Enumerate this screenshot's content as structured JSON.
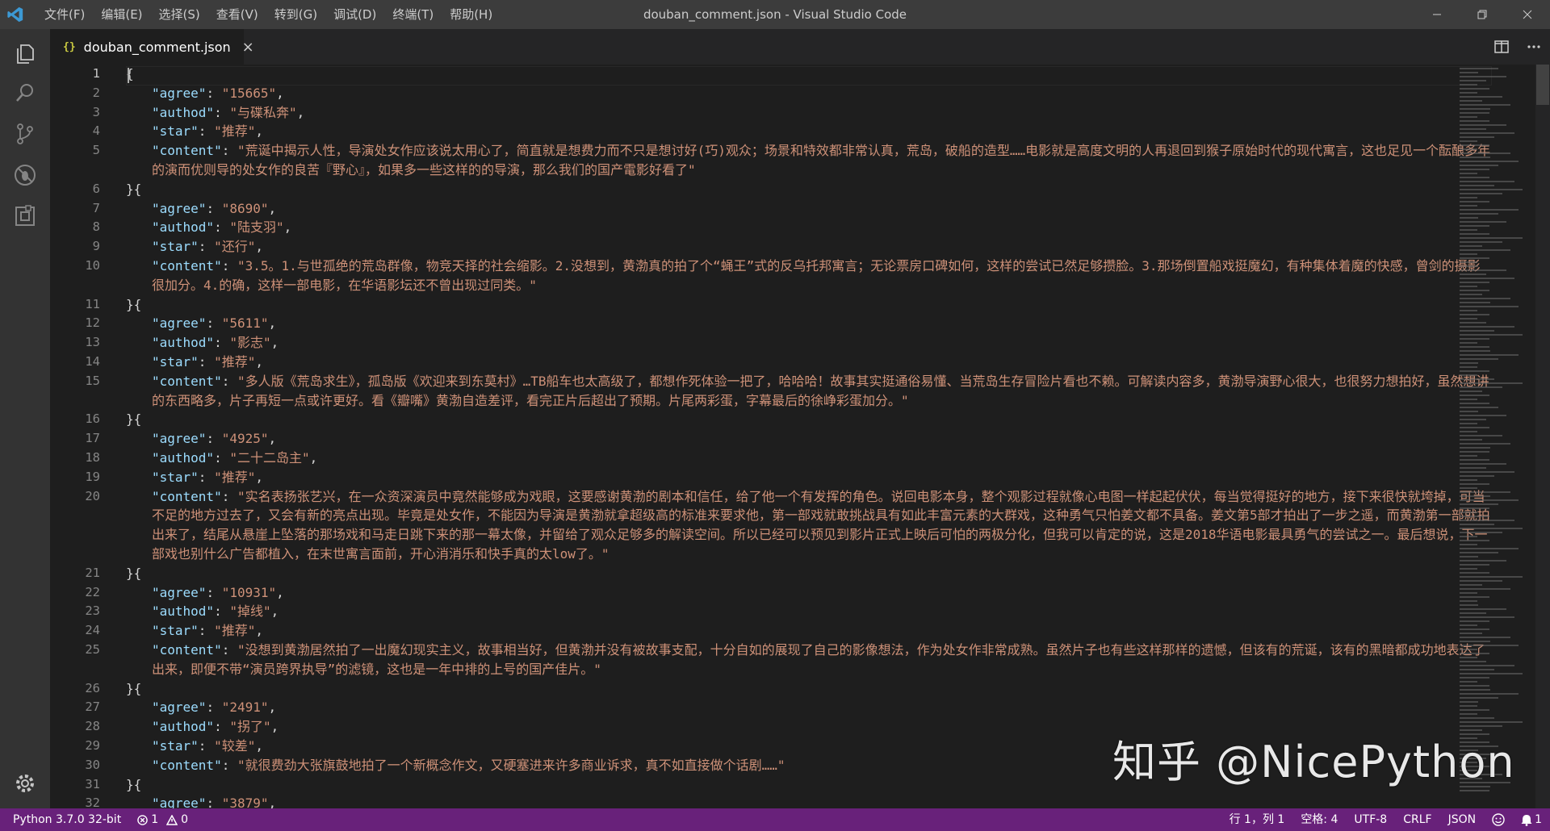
{
  "titlebar": {
    "menu": [
      "文件(F)",
      "编辑(E)",
      "选择(S)",
      "查看(V)",
      "转到(G)",
      "调试(D)",
      "终端(T)",
      "帮助(H)"
    ],
    "title": "douban_comment.json - Visual Studio Code"
  },
  "activitybar": {
    "items": [
      "explorer-icon",
      "search-icon",
      "source-control-icon",
      "debug-icon",
      "extensions-icon"
    ],
    "bottom": "gear-icon"
  },
  "tab": {
    "icon_text": "{}",
    "label": "douban_comment.json",
    "close": "×"
  },
  "editor": {
    "line_numbers": [
      "1",
      "2",
      "3",
      "4",
      "5",
      "6",
      "7",
      "8",
      "9",
      "10",
      "11",
      "12",
      "13",
      "14",
      "15",
      "16",
      "17",
      "18",
      "19",
      "20",
      "21",
      "22",
      "23",
      "24",
      "25",
      "26",
      "27",
      "28",
      "29",
      "30",
      "31",
      "32"
    ],
    "open_brace": "{",
    "separator": "}{",
    "close_brace": "}",
    "records": [
      {
        "agree": "15665",
        "authod": "与碟私奔",
        "star": "推荐",
        "content": "荒诞中揭示人性，导演处女作应该说太用心了，简直就是想费力而不只是想讨好(巧)观众；场景和特效都非常认真，荒岛，破船的造型……电影就是高度文明的人再退回到猴子原始时代的现代寓言，这也足见一个酝酿多年的演而优则导的处女作的良苦『野心』，如果多一些这样的的导演，那么我们的国产電影好看了"
      },
      {
        "agree": "8690",
        "authod": "陆支羽",
        "star": "还行",
        "content": "3.5。1.与世孤绝的荒岛群像，物竞天择的社会缩影。2.没想到，黄渤真的拍了个“蝇王”式的反乌托邦寓言；无论票房口碑如何，这样的尝试已然足够攒脸。3.那场倒置船戏挺魔幻，有种集体着魔的快感，曾剑的摄影很加分。4.的确，这样一部电影，在华语影坛还不曾出现过同类。"
      },
      {
        "agree": "5611",
        "authod": "影志",
        "star": "推荐",
        "content": "多人版《荒岛求生》，孤岛版《欢迎来到东莫村》…TB船车也太高级了，都想作死体验一把了，哈哈哈！故事其实挺通俗易懂、当荒岛生存冒险片看也不赖。可解读内容多，黄渤导演野心很大，也很努力想拍好，虽然想讲的东西略多，片子再短一点或许更好。看《瓣嘴》黄渤自造差评，看完正片后超出了预期。片尾两彩蛋，字幕最后的徐峥彩蛋加分。"
      },
      {
        "agree": "4925",
        "authod": "二十二岛主",
        "star": "推荐",
        "content": "实名表扬张艺兴，在一众资深演员中竟然能够成为戏眼，这要感谢黄渤的剧本和信任，给了他一个有发挥的角色。说回电影本身，整个观影过程就像心电图一样起起伏伏，每当觉得挺好的地方，接下来很快就垮掉，可当不足的地方过去了，又会有新的亮点出现。毕竟是处女作，不能因为导演是黄渤就拿超级高的标准来要求他，第一部戏就敢挑战具有如此丰富元素的大群戏，这种勇气只怕姜文都不具备。姜文第5部才拍出了一步之遥，而黄渤第一部就拍出来了，结尾从悬崖上坠落的那场戏和马走日跳下来的那一幕太像，并留给了观众足够多的解读空间。所以已经可以预见到影片正式上映后可怕的两极分化，但我可以肯定的说，这是2018华语电影最具勇气的尝试之一。最后想说，下一部戏也别什么广告都植入，在末世寓言面前，开心消消乐和快手真的太low了。"
      },
      {
        "agree": "10931",
        "authod": "掉线",
        "star": "推荐",
        "content": "没想到黄渤居然拍了一出魔幻现实主义，故事相当好，但黄渤并没有被故事支配，十分自如的展现了自己的影像想法，作为处女作非常成熟。虽然片子也有些这样那样的遗憾，但该有的荒诞，该有的黑暗都成功地表达了出来，即便不带“演员跨界执导”的滤镜，这也是一年中排的上号的国产佳片。"
      },
      {
        "agree": "2491",
        "authod": "拐了",
        "star": "较差",
        "content": "就很费劲大张旗鼓地拍了一个新概念作文，又硬塞进来许多商业诉求，真不如直接做个话剧……"
      },
      {
        "agree": "3879"
      }
    ]
  },
  "statusbar": {
    "python": "Python 3.7.0 32-bit",
    "errors": "1",
    "warnings": "0",
    "position": "行 1，列 1",
    "spaces": "空格: 4",
    "encoding": "UTF-8",
    "eol": "CRLF",
    "language": "JSON",
    "notifications": "1"
  },
  "watermark": "知乎 @NicePython",
  "colors": {
    "key": "#9cdcfe",
    "string": "#ce9178",
    "statusbar": "#68217a",
    "editor_bg": "#1e1e1e"
  }
}
